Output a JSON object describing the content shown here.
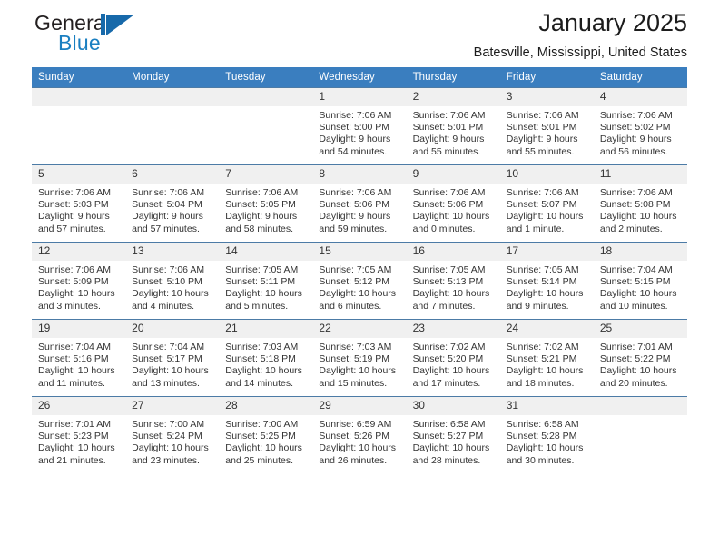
{
  "brand": {
    "name_top": "General",
    "name_bottom": "Blue",
    "mark": "blue-triangle-logo",
    "accent_color": "#1769aa"
  },
  "header": {
    "title": "January 2025",
    "location": "Batesville, Mississippi, United States",
    "header_bg_color": "#3a7ebf"
  },
  "calendar": {
    "weekdays": [
      "Sunday",
      "Monday",
      "Tuesday",
      "Wednesday",
      "Thursday",
      "Friday",
      "Saturday"
    ],
    "weeks": [
      [
        {
          "day": "",
          "sunrise": "",
          "sunset": "",
          "daylight1": "",
          "daylight2": ""
        },
        {
          "day": "",
          "sunrise": "",
          "sunset": "",
          "daylight1": "",
          "daylight2": ""
        },
        {
          "day": "",
          "sunrise": "",
          "sunset": "",
          "daylight1": "",
          "daylight2": ""
        },
        {
          "day": "1",
          "sunrise": "Sunrise: 7:06 AM",
          "sunset": "Sunset: 5:00 PM",
          "daylight1": "Daylight: 9 hours",
          "daylight2": "and 54 minutes."
        },
        {
          "day": "2",
          "sunrise": "Sunrise: 7:06 AM",
          "sunset": "Sunset: 5:01 PM",
          "daylight1": "Daylight: 9 hours",
          "daylight2": "and 55 minutes."
        },
        {
          "day": "3",
          "sunrise": "Sunrise: 7:06 AM",
          "sunset": "Sunset: 5:01 PM",
          "daylight1": "Daylight: 9 hours",
          "daylight2": "and 55 minutes."
        },
        {
          "day": "4",
          "sunrise": "Sunrise: 7:06 AM",
          "sunset": "Sunset: 5:02 PM",
          "daylight1": "Daylight: 9 hours",
          "daylight2": "and 56 minutes."
        }
      ],
      [
        {
          "day": "5",
          "sunrise": "Sunrise: 7:06 AM",
          "sunset": "Sunset: 5:03 PM",
          "daylight1": "Daylight: 9 hours",
          "daylight2": "and 57 minutes."
        },
        {
          "day": "6",
          "sunrise": "Sunrise: 7:06 AM",
          "sunset": "Sunset: 5:04 PM",
          "daylight1": "Daylight: 9 hours",
          "daylight2": "and 57 minutes."
        },
        {
          "day": "7",
          "sunrise": "Sunrise: 7:06 AM",
          "sunset": "Sunset: 5:05 PM",
          "daylight1": "Daylight: 9 hours",
          "daylight2": "and 58 minutes."
        },
        {
          "day": "8",
          "sunrise": "Sunrise: 7:06 AM",
          "sunset": "Sunset: 5:06 PM",
          "daylight1": "Daylight: 9 hours",
          "daylight2": "and 59 minutes."
        },
        {
          "day": "9",
          "sunrise": "Sunrise: 7:06 AM",
          "sunset": "Sunset: 5:06 PM",
          "daylight1": "Daylight: 10 hours",
          "daylight2": "and 0 minutes."
        },
        {
          "day": "10",
          "sunrise": "Sunrise: 7:06 AM",
          "sunset": "Sunset: 5:07 PM",
          "daylight1": "Daylight: 10 hours",
          "daylight2": "and 1 minute."
        },
        {
          "day": "11",
          "sunrise": "Sunrise: 7:06 AM",
          "sunset": "Sunset: 5:08 PM",
          "daylight1": "Daylight: 10 hours",
          "daylight2": "and 2 minutes."
        }
      ],
      [
        {
          "day": "12",
          "sunrise": "Sunrise: 7:06 AM",
          "sunset": "Sunset: 5:09 PM",
          "daylight1": "Daylight: 10 hours",
          "daylight2": "and 3 minutes."
        },
        {
          "day": "13",
          "sunrise": "Sunrise: 7:06 AM",
          "sunset": "Sunset: 5:10 PM",
          "daylight1": "Daylight: 10 hours",
          "daylight2": "and 4 minutes."
        },
        {
          "day": "14",
          "sunrise": "Sunrise: 7:05 AM",
          "sunset": "Sunset: 5:11 PM",
          "daylight1": "Daylight: 10 hours",
          "daylight2": "and 5 minutes."
        },
        {
          "day": "15",
          "sunrise": "Sunrise: 7:05 AM",
          "sunset": "Sunset: 5:12 PM",
          "daylight1": "Daylight: 10 hours",
          "daylight2": "and 6 minutes."
        },
        {
          "day": "16",
          "sunrise": "Sunrise: 7:05 AM",
          "sunset": "Sunset: 5:13 PM",
          "daylight1": "Daylight: 10 hours",
          "daylight2": "and 7 minutes."
        },
        {
          "day": "17",
          "sunrise": "Sunrise: 7:05 AM",
          "sunset": "Sunset: 5:14 PM",
          "daylight1": "Daylight: 10 hours",
          "daylight2": "and 9 minutes."
        },
        {
          "day": "18",
          "sunrise": "Sunrise: 7:04 AM",
          "sunset": "Sunset: 5:15 PM",
          "daylight1": "Daylight: 10 hours",
          "daylight2": "and 10 minutes."
        }
      ],
      [
        {
          "day": "19",
          "sunrise": "Sunrise: 7:04 AM",
          "sunset": "Sunset: 5:16 PM",
          "daylight1": "Daylight: 10 hours",
          "daylight2": "and 11 minutes."
        },
        {
          "day": "20",
          "sunrise": "Sunrise: 7:04 AM",
          "sunset": "Sunset: 5:17 PM",
          "daylight1": "Daylight: 10 hours",
          "daylight2": "and 13 minutes."
        },
        {
          "day": "21",
          "sunrise": "Sunrise: 7:03 AM",
          "sunset": "Sunset: 5:18 PM",
          "daylight1": "Daylight: 10 hours",
          "daylight2": "and 14 minutes."
        },
        {
          "day": "22",
          "sunrise": "Sunrise: 7:03 AM",
          "sunset": "Sunset: 5:19 PM",
          "daylight1": "Daylight: 10 hours",
          "daylight2": "and 15 minutes."
        },
        {
          "day": "23",
          "sunrise": "Sunrise: 7:02 AM",
          "sunset": "Sunset: 5:20 PM",
          "daylight1": "Daylight: 10 hours",
          "daylight2": "and 17 minutes."
        },
        {
          "day": "24",
          "sunrise": "Sunrise: 7:02 AM",
          "sunset": "Sunset: 5:21 PM",
          "daylight1": "Daylight: 10 hours",
          "daylight2": "and 18 minutes."
        },
        {
          "day": "25",
          "sunrise": "Sunrise: 7:01 AM",
          "sunset": "Sunset: 5:22 PM",
          "daylight1": "Daylight: 10 hours",
          "daylight2": "and 20 minutes."
        }
      ],
      [
        {
          "day": "26",
          "sunrise": "Sunrise: 7:01 AM",
          "sunset": "Sunset: 5:23 PM",
          "daylight1": "Daylight: 10 hours",
          "daylight2": "and 21 minutes."
        },
        {
          "day": "27",
          "sunrise": "Sunrise: 7:00 AM",
          "sunset": "Sunset: 5:24 PM",
          "daylight1": "Daylight: 10 hours",
          "daylight2": "and 23 minutes."
        },
        {
          "day": "28",
          "sunrise": "Sunrise: 7:00 AM",
          "sunset": "Sunset: 5:25 PM",
          "daylight1": "Daylight: 10 hours",
          "daylight2": "and 25 minutes."
        },
        {
          "day": "29",
          "sunrise": "Sunrise: 6:59 AM",
          "sunset": "Sunset: 5:26 PM",
          "daylight1": "Daylight: 10 hours",
          "daylight2": "and 26 minutes."
        },
        {
          "day": "30",
          "sunrise": "Sunrise: 6:58 AM",
          "sunset": "Sunset: 5:27 PM",
          "daylight1": "Daylight: 10 hours",
          "daylight2": "and 28 minutes."
        },
        {
          "day": "31",
          "sunrise": "Sunrise: 6:58 AM",
          "sunset": "Sunset: 5:28 PM",
          "daylight1": "Daylight: 10 hours",
          "daylight2": "and 30 minutes."
        },
        {
          "day": "",
          "sunrise": "",
          "sunset": "",
          "daylight1": "",
          "daylight2": ""
        }
      ]
    ]
  }
}
